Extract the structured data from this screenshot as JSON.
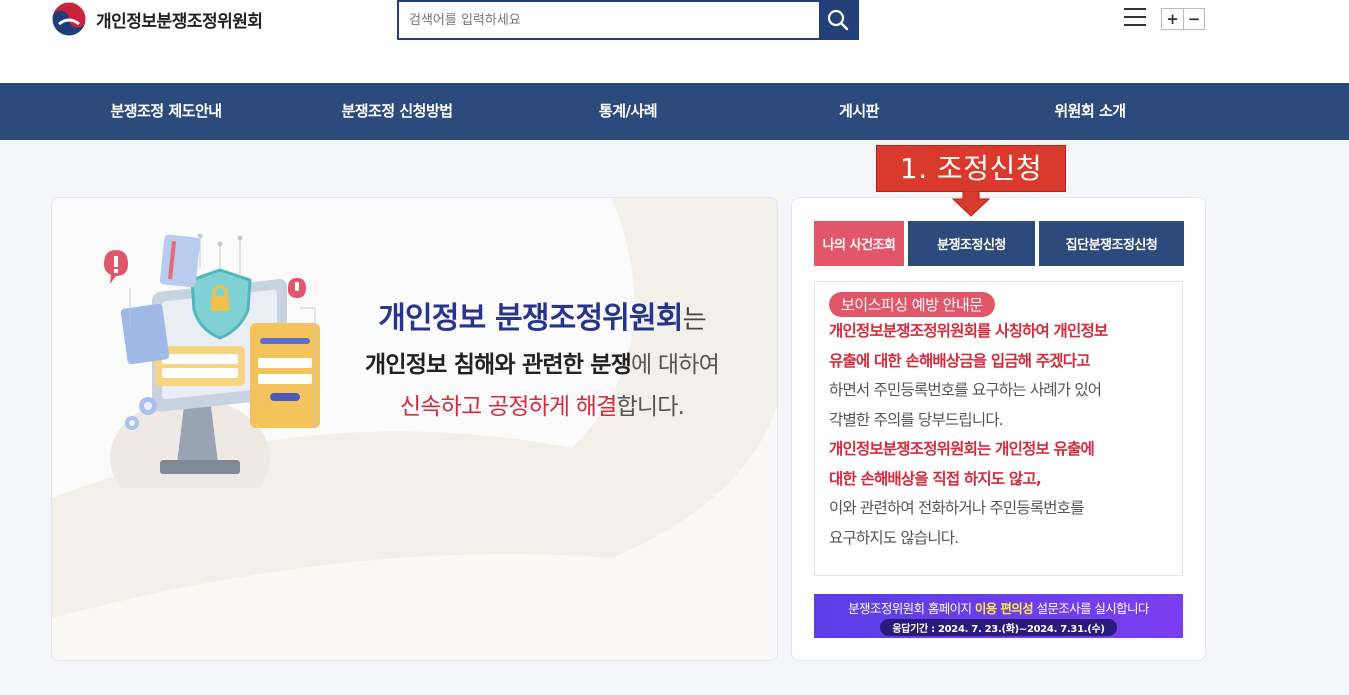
{
  "header": {
    "site_title": "개인정보분쟁조정위원회",
    "search_placeholder": "검색어를 입력하세요",
    "zoom_in_label": "+",
    "zoom_out_label": "−"
  },
  "nav": {
    "items": [
      {
        "label": "분쟁조정 제도안내"
      },
      {
        "label": "분쟁조정 신청방법"
      },
      {
        "label": "통계/사례"
      },
      {
        "label": "게시판"
      },
      {
        "label": "위원회 소개"
      }
    ]
  },
  "hero": {
    "line1_strong": "개인정보 분쟁조정위원회",
    "line1_rest": "는",
    "line2_strong": "개인정보 침해와 관련한 분쟁",
    "line2_rest": "에 대하여",
    "line3_strong": "신속하고 공정하게 해결",
    "line3_rest": "합니다."
  },
  "side": {
    "buttons": {
      "my_case": "나의 사건조회",
      "apply": "분쟁조정신청",
      "group_apply": "집단분쟁조정신청"
    },
    "notice": {
      "badge": "보이스피싱 예방 안내문",
      "lines": [
        "개인정보분쟁조정위원회를 사칭하여 개인정보",
        "유출에 대한 손해배상금을 입금해 주겠다고",
        "하면서 주민등록번호를 요구하는 사례가 있어",
        "각별한 주의를 당부드립니다.",
        "개인정보분쟁조정위원회는 개인정보 유출에",
        "대한 손해배상을 직접 하지도 않고,",
        "이와 관련하여 전화하거나 주민등록번호를",
        "요구하지도 않습니다."
      ]
    },
    "banner": {
      "text_before": "분쟁조정위원회 홈페이지 ",
      "highlight": "이용 편의성",
      "text_after": " 설문조사를 실시합니다",
      "period": "응답기간 :  2024. 7. 23.(화)~2024. 7.31.(수)"
    }
  },
  "annotation": {
    "callout": "1. 조정신청"
  },
  "colors": {
    "navy": "#2c4a7c",
    "pink": "#e2566a",
    "red": "#d62b3d",
    "callout": "#d93a2b",
    "banner": "#5a3de6"
  }
}
